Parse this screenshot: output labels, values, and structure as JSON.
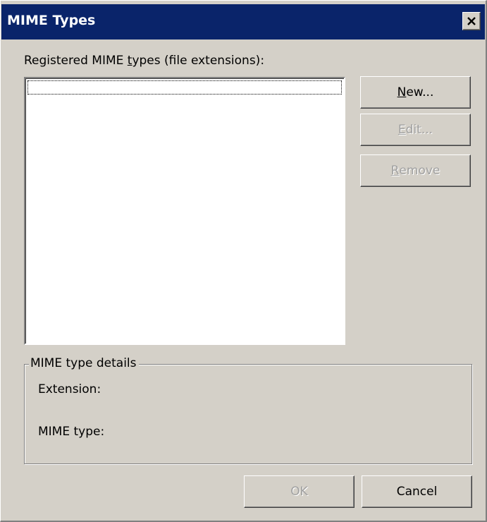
{
  "window": {
    "title": "MIME Types",
    "close_icon": "close-icon"
  },
  "list": {
    "label_before": "Registered MIME ",
    "label_mnemonic": "t",
    "label_after": "ypes (file extensions):",
    "items": []
  },
  "buttons": {
    "new": {
      "mnemonic": "N",
      "rest": "ew..."
    },
    "edit": {
      "mnemonic": "E",
      "rest": "dit..."
    },
    "remove": {
      "mnemonic": "R",
      "rest": "emove"
    },
    "ok": "OK",
    "cancel": "Cancel"
  },
  "details": {
    "legend": "MIME type details",
    "extension_label": "Extension:",
    "extension_value": "",
    "mime_type_label": "MIME type:",
    "mime_type_value": ""
  },
  "colors": {
    "dialog_bg": "#d4d0c8",
    "titlebar_bg": "#0a246a",
    "title_text": "#ffffff",
    "disabled_text": "#a0a0a0"
  }
}
